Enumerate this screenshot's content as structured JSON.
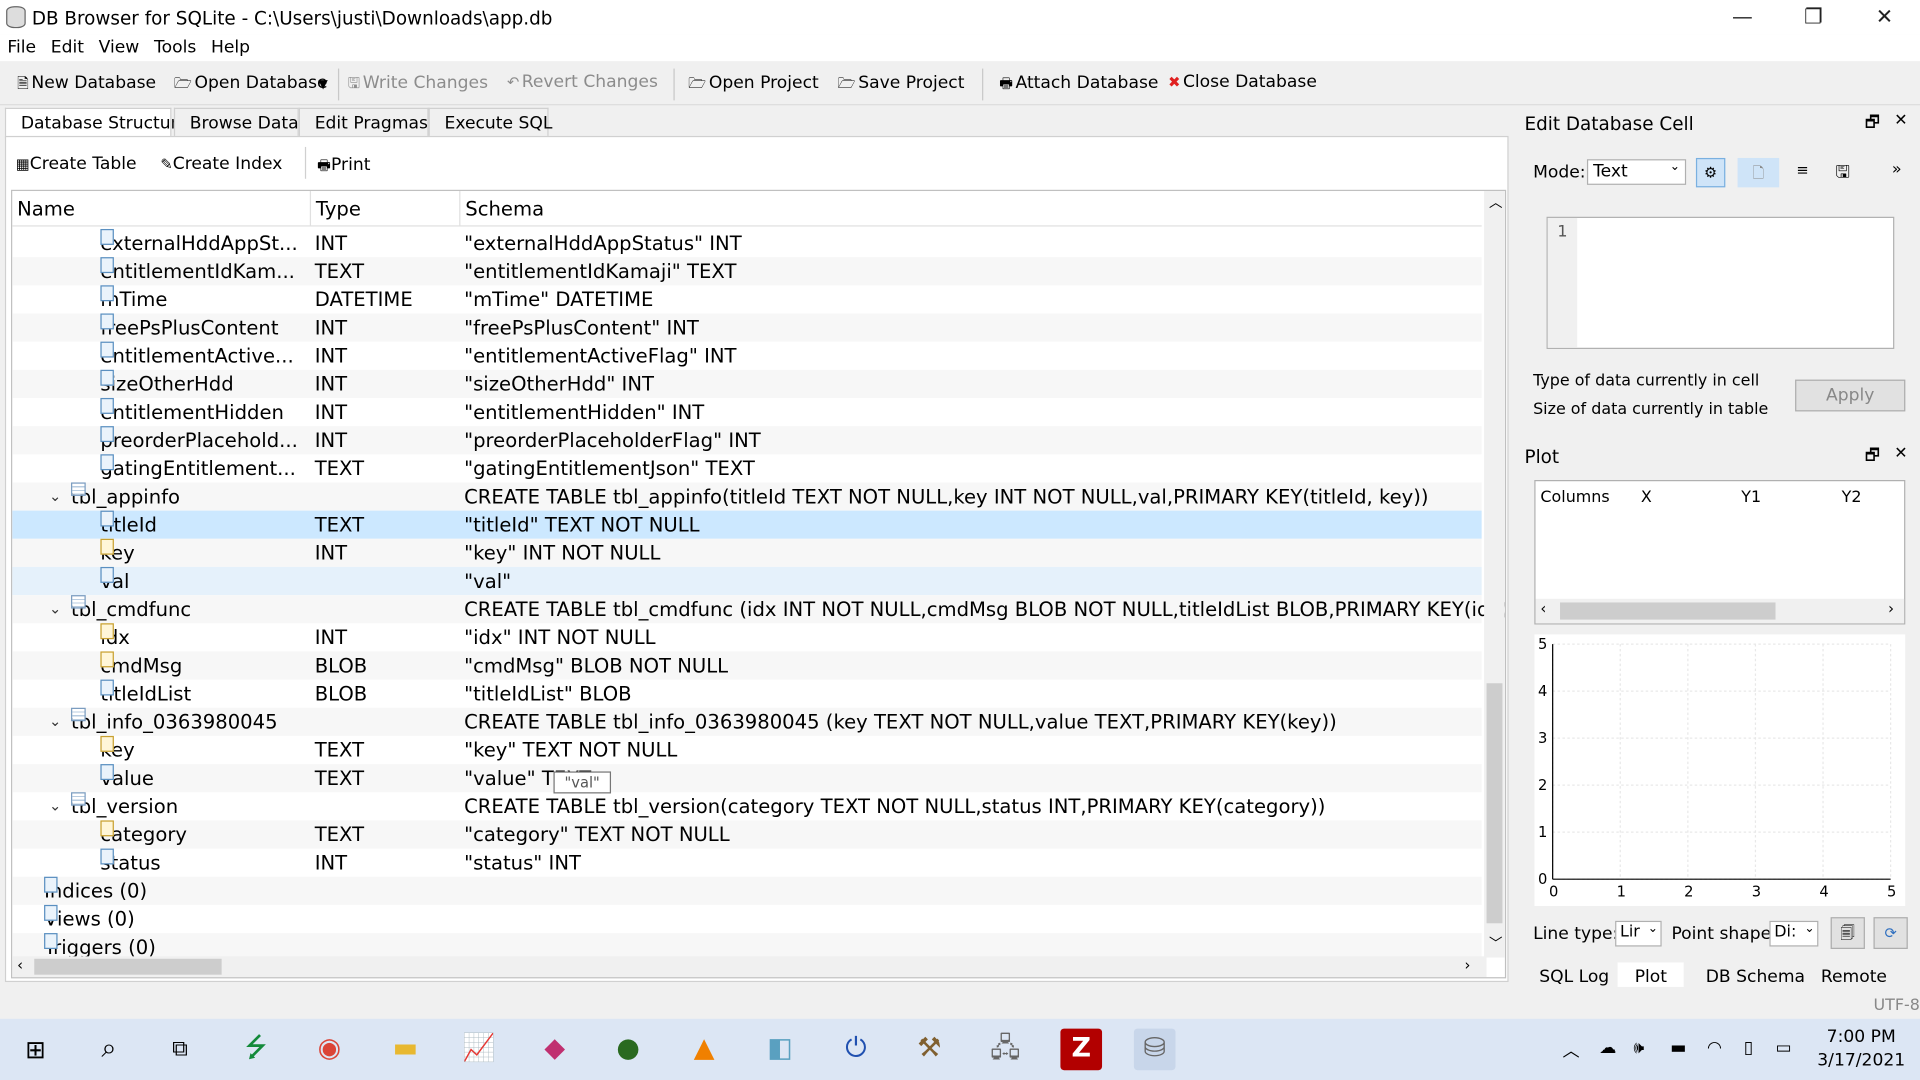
{
  "window": {
    "title": "DB Browser for SQLite - C:\\Users\\justi\\Downloads\\app.db",
    "min": "—",
    "max": "❐",
    "close": "✕"
  },
  "menu": [
    "File",
    "Edit",
    "View",
    "Tools",
    "Help"
  ],
  "toolbar": {
    "new_db": "New Database",
    "open_db": "Open Database",
    "write": "Write Changes",
    "revert": "Revert Changes",
    "open_proj": "Open Project",
    "save_proj": "Save Project",
    "attach": "Attach Database",
    "close_db": "Close Database"
  },
  "tabs": [
    "Database Structure",
    "Browse Data",
    "Edit Pragmas",
    "Execute SQL"
  ],
  "subtoolbar": {
    "create_table": "Create Table",
    "create_index": "Create Index",
    "print": "Print"
  },
  "tree": {
    "headers": [
      "Name",
      "Type",
      "Schema"
    ],
    "rows": [
      {
        "name": "externalHddAppSt...",
        "type": "INT",
        "schema": "\"externalHddAppStatus\" INT"
      },
      {
        "name": "entitlementIdKam...",
        "type": "TEXT",
        "schema": "\"entitlementIdKamaji\" TEXT"
      },
      {
        "name": "mTime",
        "type": "DATETIME",
        "schema": "\"mTime\" DATETIME"
      },
      {
        "name": "freePsPlusContent",
        "type": "INT",
        "schema": "\"freePsPlusContent\" INT"
      },
      {
        "name": "entitlementActive...",
        "type": "INT",
        "schema": "\"entitlementActiveFlag\" INT"
      },
      {
        "name": "sizeOtherHdd",
        "type": "INT",
        "schema": "\"sizeOtherHdd\" INT"
      },
      {
        "name": "entitlementHidden",
        "type": "INT",
        "schema": "\"entitlementHidden\" INT"
      },
      {
        "name": "preorderPlacehold...",
        "type": "INT",
        "schema": "\"preorderPlaceholderFlag\" INT"
      },
      {
        "name": "gatingEntitlement...",
        "type": "TEXT",
        "schema": "\"gatingEntitlementJson\" TEXT"
      },
      {
        "name": "tbl_appinfo",
        "type": "",
        "schema": "CREATE TABLE tbl_appinfo(titleId TEXT NOT NULL,key INT NOT NULL,val,PRIMARY KEY(titleId, key))"
      },
      {
        "name": "titleId",
        "type": "TEXT",
        "schema": "\"titleId\" TEXT NOT NULL"
      },
      {
        "name": "key",
        "type": "INT",
        "schema": "\"key\" INT NOT NULL"
      },
      {
        "name": "val",
        "type": "",
        "schema": "\"val\""
      },
      {
        "name": "tbl_cmdfunc",
        "type": "",
        "schema": "CREATE TABLE tbl_cmdfunc (idx INT NOT NULL,cmdMsg BLOB NOT NULL,titleIdList BLOB,PRIMARY KEY(idx))"
      },
      {
        "name": "idx",
        "type": "INT",
        "schema": "\"idx\" INT NOT NULL"
      },
      {
        "name": "cmdMsg",
        "type": "BLOB",
        "schema": "\"cmdMsg\" BLOB NOT NULL"
      },
      {
        "name": "titleIdList",
        "type": "BLOB",
        "schema": "\"titleIdList\" BLOB"
      },
      {
        "name": "tbl_info_0363980045",
        "type": "",
        "schema": "CREATE TABLE tbl_info_0363980045 (key TEXT NOT NULL,value TEXT,PRIMARY KEY(key))"
      },
      {
        "name": "key",
        "type": "TEXT",
        "schema": "\"key\" TEXT NOT NULL"
      },
      {
        "name": "value",
        "type": "TEXT",
        "schema": "\"value\" TEXT"
      },
      {
        "name": "tbl_version",
        "type": "",
        "schema": "CREATE TABLE tbl_version(category TEXT NOT NULL,status INT,PRIMARY KEY(category))"
      },
      {
        "name": "category",
        "type": "TEXT",
        "schema": "\"category\" TEXT NOT NULL"
      },
      {
        "name": "status",
        "type": "INT",
        "schema": "\"status\" INT"
      },
      {
        "name": "Indices (0)",
        "type": "",
        "schema": ""
      },
      {
        "name": "Views (0)",
        "type": "",
        "schema": ""
      },
      {
        "name": "Triggers (0)",
        "type": "",
        "schema": ""
      }
    ],
    "tooltip": "\"val\""
  },
  "edit_cell": {
    "title": "Edit Database Cell",
    "mode_label": "Mode:",
    "mode_value": "Text",
    "line_no": "1",
    "type_label": "Type of data currently in cell",
    "size_label": "Size of data currently in table",
    "apply": "Apply"
  },
  "plot": {
    "title": "Plot",
    "columns": [
      "Columns",
      "X",
      "Y1",
      "Y2"
    ],
    "yticks": [
      "5",
      "4",
      "3",
      "2",
      "1",
      "0"
    ],
    "xticks": [
      "0",
      "1",
      "2",
      "3",
      "4",
      "5"
    ],
    "line_type_label": "Line type:",
    "line_type_value": "Lir",
    "point_shape_label": "Point shape:",
    "point_shape_value": "Di:"
  },
  "bottom_tabs": [
    "SQL Log",
    "Plot",
    "DB Schema",
    "Remote"
  ],
  "status": {
    "encoding": "UTF-8"
  },
  "taskbar": {
    "time": "7:00 PM",
    "date": "3/17/2021"
  }
}
